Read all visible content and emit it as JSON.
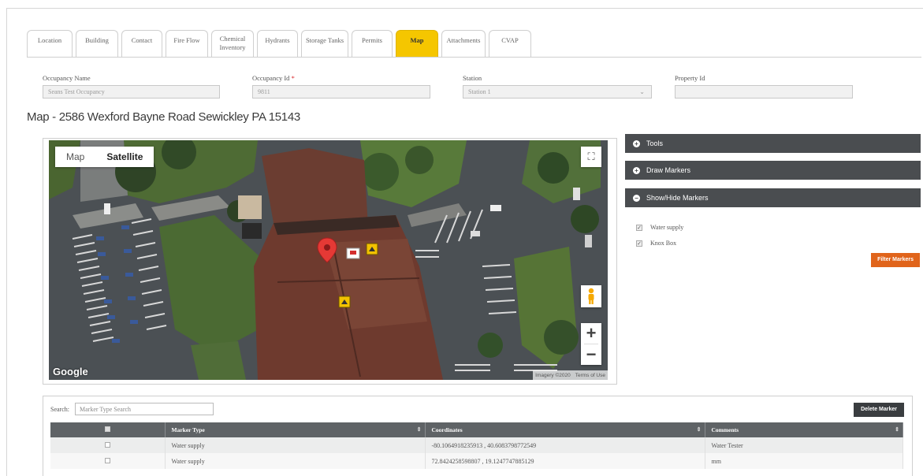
{
  "tabs": [
    {
      "label": "Location",
      "active": false
    },
    {
      "label": "Building",
      "active": false
    },
    {
      "label": "Contact",
      "active": false
    },
    {
      "label": "Fire Flow",
      "active": false
    },
    {
      "label": "Chemical\nInventory",
      "active": false
    },
    {
      "label": "Hydrants",
      "active": false
    },
    {
      "label": "Storage Tanks",
      "active": false
    },
    {
      "label": "Permits",
      "active": false
    },
    {
      "label": "Map",
      "active": true
    },
    {
      "label": "Attachments",
      "active": false
    },
    {
      "label": "CVAP",
      "active": false
    }
  ],
  "form": {
    "occupancy_name": {
      "label": "Occupancy Name",
      "value": "Seans Test Occupancy"
    },
    "occupancy_id": {
      "label": "Occupancy Id",
      "required_mark": "*",
      "value": "9811"
    },
    "station": {
      "label": "Station",
      "value": "Station 1"
    },
    "property_id": {
      "label": "Property Id",
      "value": ""
    }
  },
  "map_title": "Map - 2586 Wexford Bayne Road Sewickley PA 15143",
  "map": {
    "type_options": [
      "Map",
      "Satellite"
    ],
    "selected_type": "Satellite",
    "logo": "Google",
    "attribution": [
      "Imagery ©2020",
      "Terms of Use"
    ]
  },
  "accordion": {
    "tools": "Tools",
    "draw_markers": "Draw Markers",
    "show_hide_markers": "Show/Hide Markers"
  },
  "marker_filters": [
    {
      "label": "Water supply",
      "checked": true
    },
    {
      "label": "Knox Box",
      "checked": true
    }
  ],
  "filter_button": "Filter Markers",
  "table": {
    "search_label": "Search:",
    "search_placeholder": "Marker Type Search",
    "delete_button": "Delete Marker",
    "columns": [
      "Marker Type",
      "Coordinates",
      "Comments"
    ],
    "rows": [
      {
        "marker_type": "Water supply",
        "coordinates": "-80.1064918235913 , 40.6083798772549",
        "comments": "Water Tester"
      },
      {
        "marker_type": "Water supply",
        "coordinates": "72.8424258598807 , 19.1247747885129",
        "comments": "mm"
      }
    ]
  },
  "colors": {
    "active_tab": "#f5c600",
    "accordion_header": "#4a4d50",
    "filter_button": "#e0641b",
    "delete_button": "#3a3d40",
    "table_header": "#5f6366"
  }
}
